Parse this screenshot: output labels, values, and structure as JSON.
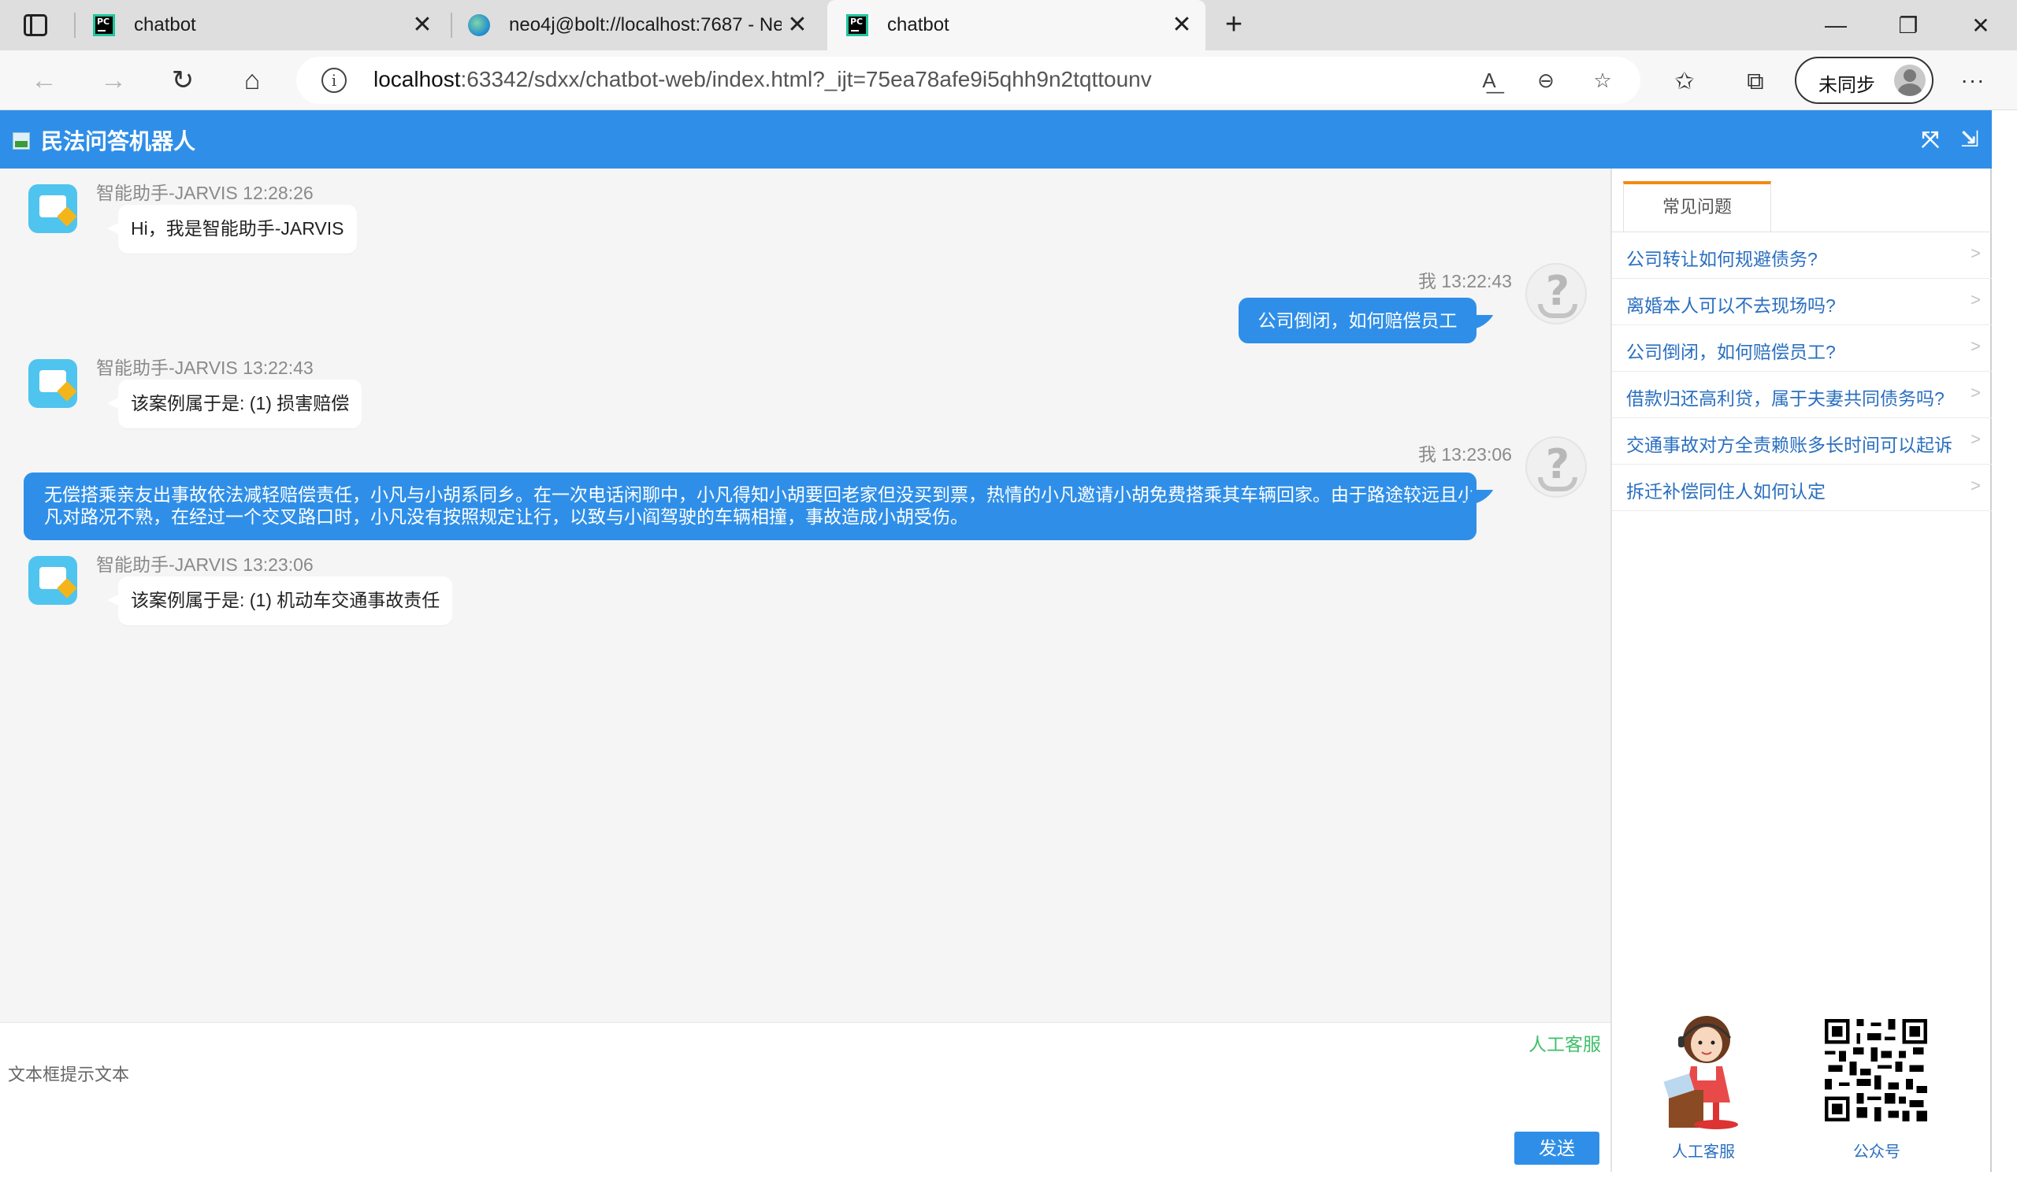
{
  "browser": {
    "tabs": [
      {
        "title": "chatbot",
        "active": false,
        "icon": "pycharm-icon"
      },
      {
        "title": "neo4j@bolt://localhost:7687 - Ne",
        "active": false,
        "icon": "neo4j-globe-icon"
      },
      {
        "title": "chatbot",
        "active": true,
        "icon": "pycharm-icon"
      }
    ],
    "url_host": "localhost",
    "url_rest": ":63342/sdxx/chatbot-web/index.html?_ijt=75ea78afe9i5qhh9n2tqttounv",
    "sync_label": "未同步"
  },
  "app": {
    "title": "民法问答机器人"
  },
  "messages": [
    {
      "sender": "bot",
      "meta": "智能助手-JARVIS 12:28:26",
      "text": "Hi，我是智能助手-JARVIS"
    },
    {
      "sender": "me",
      "meta": "我 13:22:43",
      "text": "公司倒闭，如何赔偿员工"
    },
    {
      "sender": "bot",
      "meta": "智能助手-JARVIS 13:22:43",
      "text": "该案例属于是: (1) 损害赔偿"
    },
    {
      "sender": "me",
      "meta": "我 13:23:06",
      "text_line1": "无偿搭乘亲友出事故依法减轻赔偿责任，小凡与小胡系同乡。在一次电话闲聊中，小凡得知小胡要回老家但没买到票，热情的小凡邀请小胡免费搭乘其车辆回家。由于路途较远且小",
      "text_line2": "凡对路况不熟，在经过一个交叉路口时，小凡没有按照规定让行，以致与小阎驾驶的车辆相撞，事故造成小胡受伤。"
    },
    {
      "sender": "bot",
      "meta": "智能助手-JARVIS 13:23:06",
      "text": "该案例属于是: (1) 机动车交通事故责任"
    }
  ],
  "input": {
    "placeholder": "文本框提示文本",
    "human_service_link": "人工客服",
    "send_label": "发送"
  },
  "sidebar": {
    "tab_label": "常见问题",
    "faq": [
      "公司转让如何规避债务?",
      "离婚本人可以不去现场吗?",
      "公司倒闭，如何赔偿员工?",
      "借款归还高利贷，属于夫妻共同债务吗?",
      "交通事故对方全责赖账多长时间可以起诉",
      "拆迁补偿同住人如何认定"
    ],
    "arrow": ">",
    "customer_service_label": "人工客服",
    "official_account_label": "公众号"
  },
  "colors": {
    "primary": "#2f8fe8",
    "tab_accent": "#f28a16",
    "link": "#2a6fc0",
    "human_link": "#3fbf6a"
  }
}
